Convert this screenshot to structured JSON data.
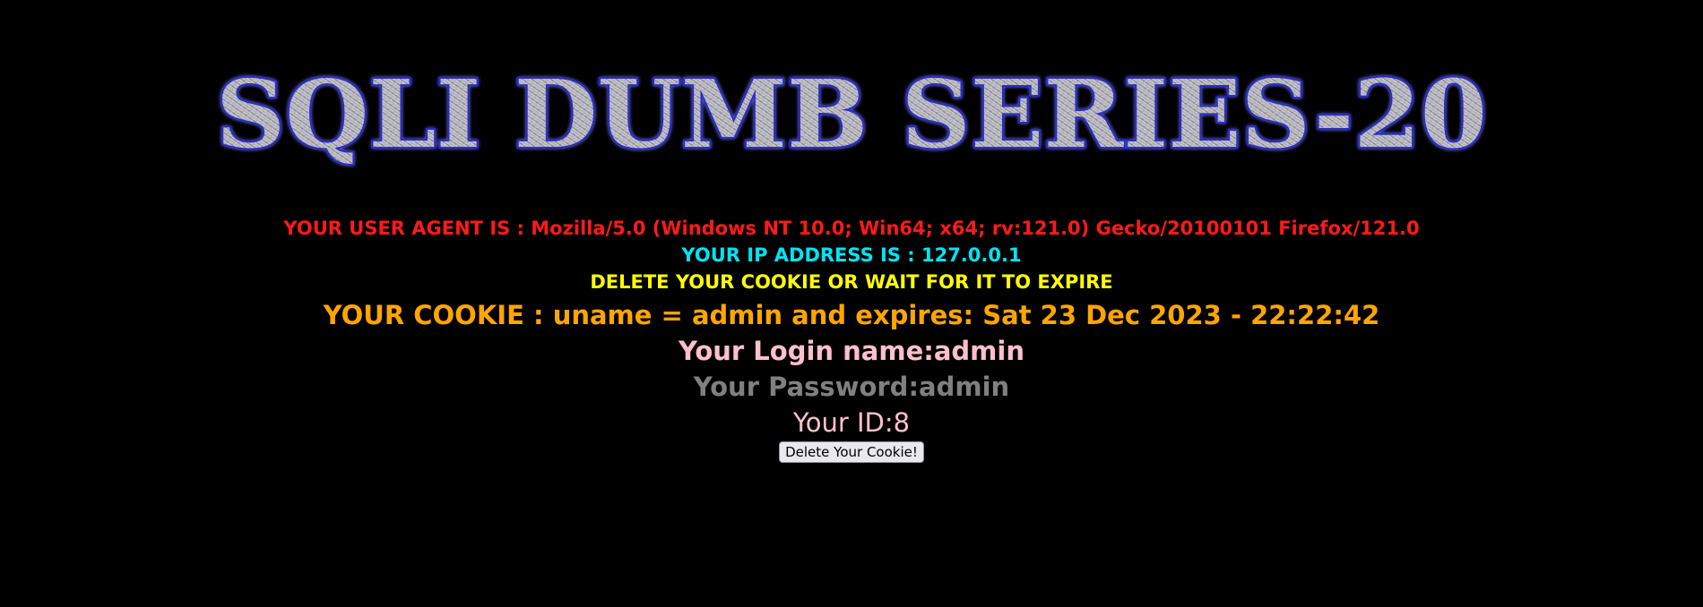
{
  "banner": {
    "title": "SQLI DUMB SERIES-20"
  },
  "info": {
    "user_agent": "YOUR USER AGENT IS : Mozilla/5.0 (Windows NT 10.0; Win64; x64; rv:121.0) Gecko/20100101 Firefox/121.0",
    "ip_address": "YOUR IP ADDRESS IS : 127.0.0.1",
    "delete_message": "DELETE YOUR COOKIE OR WAIT FOR IT TO EXPIRE",
    "cookie": "YOUR COOKIE : uname = admin and expires: Sat 23 Dec 2023 - 22:22:42",
    "login_name": "Your Login name:admin",
    "password": "Your Password:admin",
    "id": "Your ID:8"
  },
  "form": {
    "delete_button_label": "Delete Your Cookie!"
  },
  "colors": {
    "background": "#000000",
    "user_agent": "#ff1a1a",
    "ip_address": "#00e5f2",
    "delete_message": "#ffff00",
    "cookie": "#ffa500",
    "login_name": "#ffc0cb",
    "password": "#808080",
    "id": "#ffc0cb",
    "banner_outline": "#2a2ad0"
  }
}
